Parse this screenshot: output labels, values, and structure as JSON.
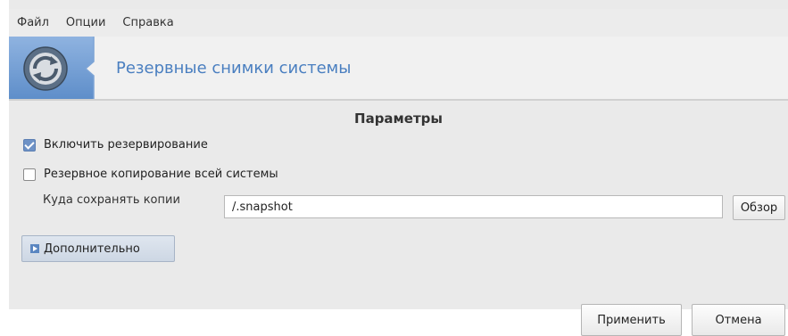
{
  "menu": {
    "items": [
      "Файл",
      "Опции",
      "Справка"
    ]
  },
  "header": {
    "title": "Резервные снимки системы",
    "logo_icon": "backup-icon"
  },
  "section": {
    "title": "Параметры"
  },
  "options": {
    "enable_backup": {
      "label": "Включить резервирование",
      "checked": true
    },
    "full_system": {
      "label": "Резервное копирование всей системы",
      "checked": false
    }
  },
  "path": {
    "label": "Куда сохранять копии",
    "value": "/.snapshot",
    "browse_label": "Обзор"
  },
  "advanced": {
    "label": "Дополнительно"
  },
  "actions": {
    "apply_label": "Применить",
    "cancel_label": "Отмена"
  },
  "colors": {
    "accent": "#4a7fc0",
    "banner_blue": "#6f9bd2"
  }
}
